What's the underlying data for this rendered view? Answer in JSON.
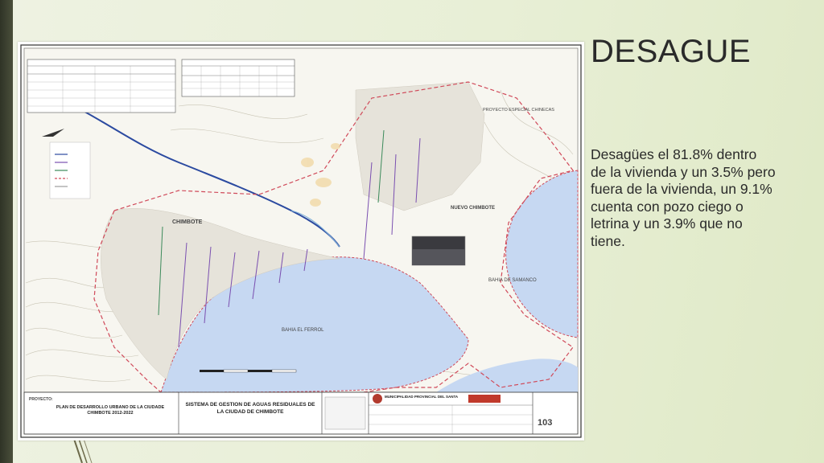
{
  "slide": {
    "title": "DESAGUE",
    "body": "Desagües el 81.8% dentro de la vivienda y un 3.5% pero fuera de la vivienda, un 9.1% cuenta con pozo ciego o letrina y un 3.9% que no tiene."
  },
  "map": {
    "labels": {
      "chimbote": "CHIMBOTE",
      "nuevo_chimbote": "NUEVO CHIMBOTE",
      "bahia_ferrol": "BAHIA EL FERROL",
      "bahia_samanco": "BAHIA DE SAMANCO",
      "proyecto_chinecas": "PROYECTO ESPECIAL CHINECAS"
    },
    "title_block": {
      "proyecto_label": "PROYECTO:",
      "proyecto_name": "PLAN DE DESARROLLO URBANO DE LA CIUDADE CHIMBOTE 2012-2022",
      "sheet_title": "SISTEMA DE GESTION DE AGUAS RESIDUALES DE LA CIUDAD DE CHIMBOTE",
      "municipality": "MUNICIPALIDAD PROVINCIAL DEL SANTA",
      "sheet_number": "103"
    },
    "colors": {
      "sea": "#c6d8f2",
      "sea_edge": "#d04a5a",
      "boundary": "#d04a5a",
      "river": "#2b4aa0"
    }
  }
}
